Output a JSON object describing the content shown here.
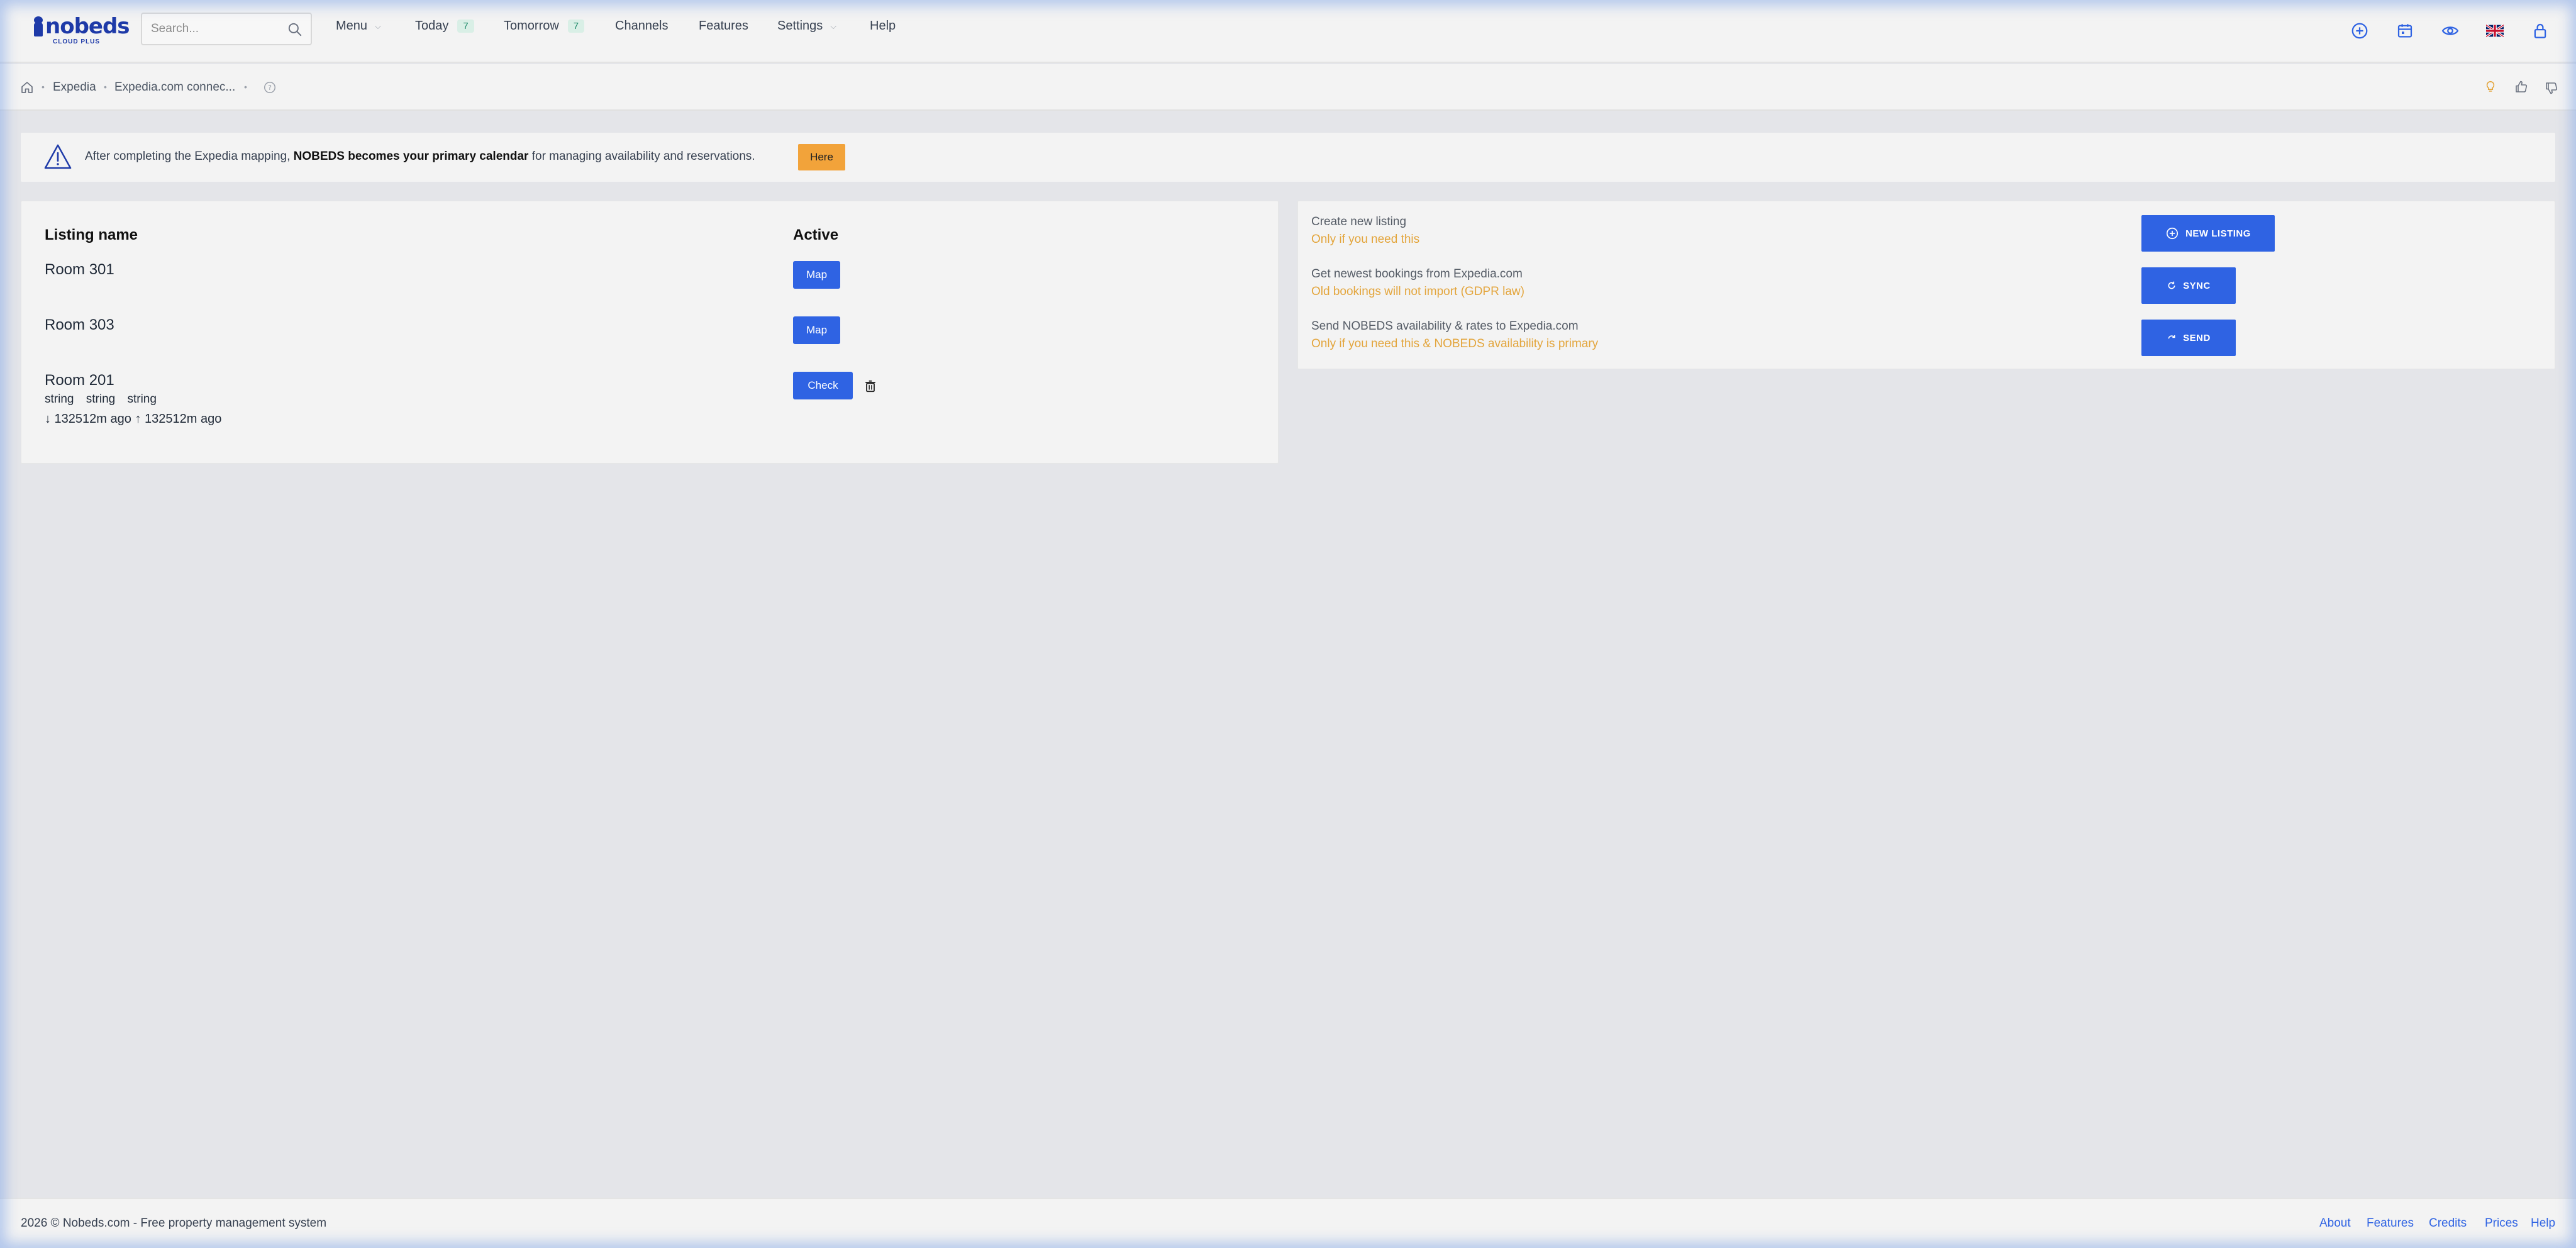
{
  "brand": {
    "name": "nobeds",
    "tagline": "CLOUD PLUS",
    "color": "#1e3aa8"
  },
  "search": {
    "placeholder": "Search..."
  },
  "nav": {
    "menu": "Menu",
    "today": "Today",
    "today_count": "7",
    "tomorrow": "Tomorrow",
    "tomorrow_count": "7",
    "channels": "Channels",
    "features": "Features",
    "settings": "Settings",
    "help": "Help"
  },
  "top_icons": [
    "plus-circle-icon",
    "calendar-icon",
    "eye-icon",
    "uk-flag-icon",
    "lock-icon"
  ],
  "breadcrumb": {
    "items": [
      "Expedia",
      "Expedia.com connec..."
    ]
  },
  "alert": {
    "text_before": "After completing the Expedia mapping, ",
    "text_bold": "NOBEDS becomes your primary calendar",
    "text_after": " for managing availability and reservations.",
    "button": "Here"
  },
  "listings": {
    "col_name": "Listing name",
    "col_active": "Active",
    "rows": [
      {
        "name": "Room 301",
        "action": "Map"
      },
      {
        "name": "Room 303",
        "action": "Map"
      },
      {
        "name": "Room 201",
        "tags": "string string string",
        "sync": "↓ 132512m ago ↑ 132512m ago",
        "action": "Check"
      }
    ]
  },
  "actions": [
    {
      "title": "Create new listing",
      "note": "Only if you need this",
      "button": "NEW LISTING"
    },
    {
      "title": "Get newest bookings from Expedia.com",
      "note": "Old bookings will not import (GDPR law)",
      "button": "SYNC"
    },
    {
      "title": "Send NOBEDS availability & rates to Expedia.com",
      "note": "Only if you need this & NOBEDS availability is primary",
      "button": "SEND"
    }
  ],
  "footer": {
    "copyright": "2026  © Nobeds.com - Free property management system",
    "links": [
      "About",
      "Features",
      "Credits",
      "Prices",
      "Help"
    ]
  },
  "colors": {
    "primary": "#2f63e3",
    "warning": "#f2a33a",
    "note": "#e3a53c",
    "background": "#e4e5e9",
    "panel": "#f3f3f3"
  }
}
